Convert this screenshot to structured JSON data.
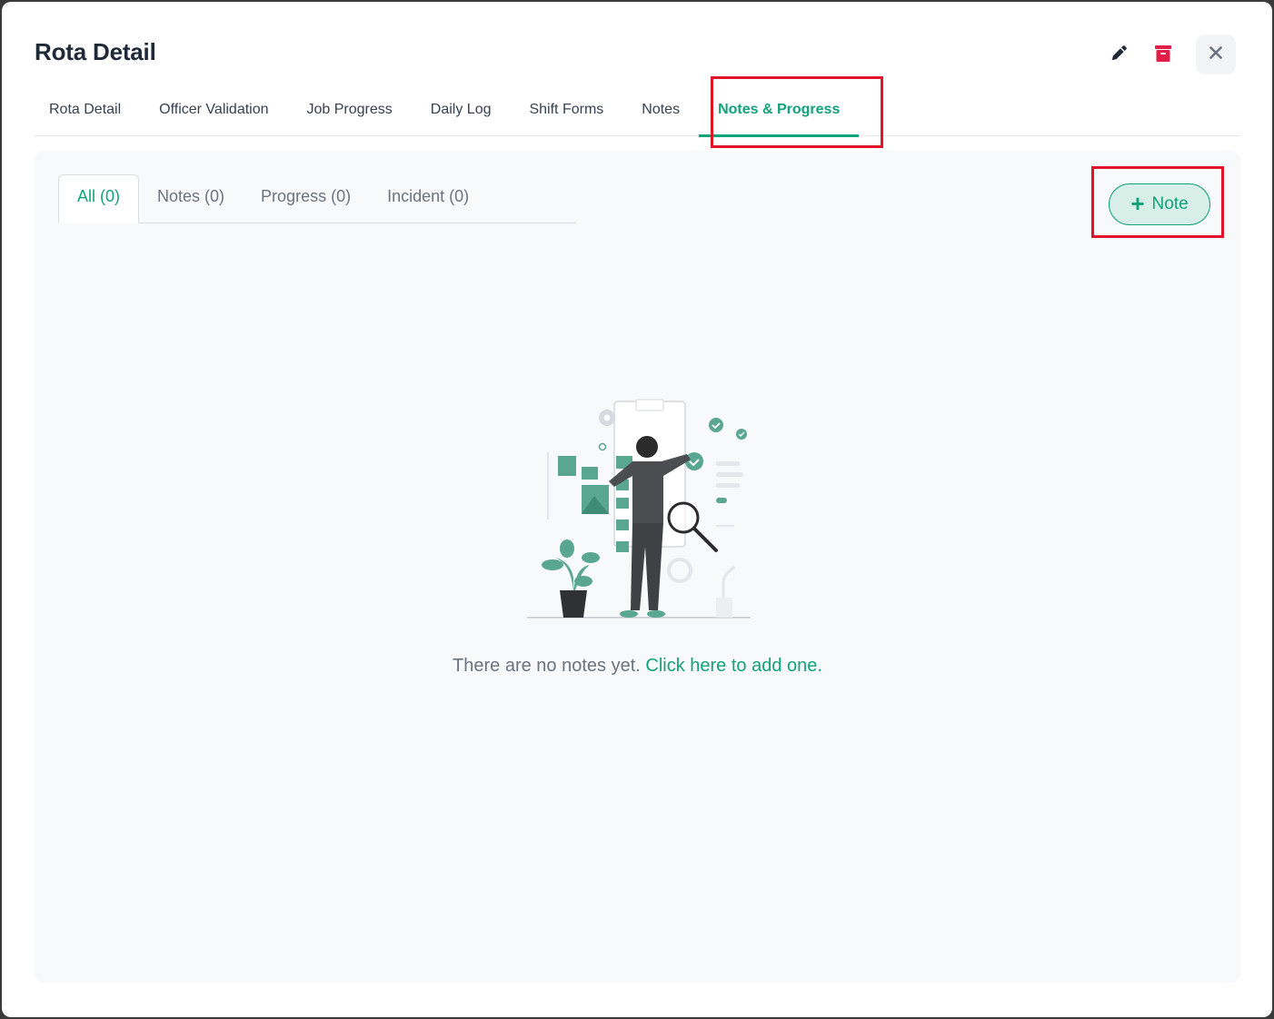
{
  "modal": {
    "title": "Rota Detail",
    "actions": {
      "edit_icon": "pencil-icon",
      "delete_icon": "trash-icon",
      "close_icon": "close-icon"
    }
  },
  "main_tabs": [
    {
      "label": "Rota Detail"
    },
    {
      "label": "Officer Validation"
    },
    {
      "label": "Job Progress"
    },
    {
      "label": "Daily Log"
    },
    {
      "label": "Shift Forms"
    },
    {
      "label": "Notes"
    },
    {
      "label": "Notes & Progress",
      "active": true
    }
  ],
  "sub_tabs": [
    {
      "label": "All (0)",
      "active": true
    },
    {
      "label": "Notes (0)"
    },
    {
      "label": "Progress (0)"
    },
    {
      "label": "Incident (0)"
    }
  ],
  "add_note_button": {
    "label": "Note",
    "icon": "plus-icon"
  },
  "empty_state": {
    "text": "There are no notes yet.",
    "link": "Click here to add one."
  },
  "colors": {
    "accent": "#12a37a",
    "highlight": "#e0142a",
    "delete": "#e11d48",
    "title": "#1f2937"
  }
}
